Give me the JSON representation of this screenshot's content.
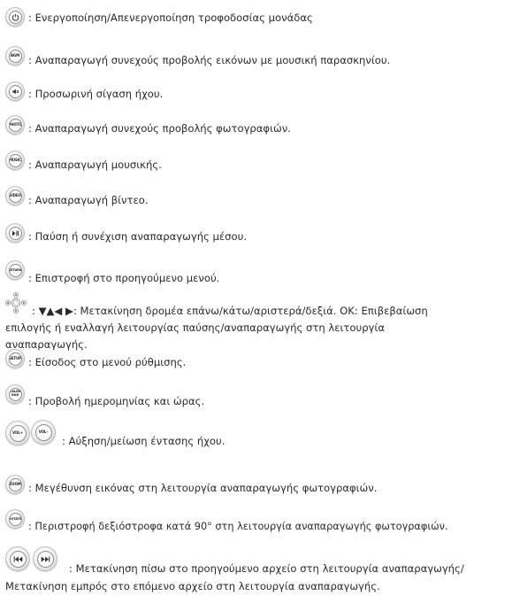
{
  "items": [
    {
      "icon": "power-icon",
      "label": "",
      "text": ": Ενεργοποίηση/Απενεργοποίηση τροφοδοσίας μονάδας"
    },
    {
      "icon": "bgm-icon",
      "label": "BGM",
      "text": ": Αναπαραγωγή συνεχούς προβολής εικόνων με μουσική παρασκηνίου."
    },
    {
      "icon": "mute-icon",
      "label": "",
      "text": ": Προσωρινή σίγαση ήχου."
    },
    {
      "icon": "photo-icon",
      "label": "PHOTO",
      "text": ": Αναπαραγωγή συνεχούς προβολής φωτογραφιών."
    },
    {
      "icon": "music-icon",
      "label": "MUSIC",
      "text": ": Αναπαραγωγή μουσικής."
    },
    {
      "icon": "video-icon",
      "label": "VIDEO",
      "text": ": Αναπαραγωγή βίντεο."
    },
    {
      "icon": "play-pause-icon",
      "label": "",
      "text": ": Παύση ή συνέχιση αναπαραγωγής μέσου."
    },
    {
      "icon": "return-icon",
      "label": "RETURN",
      "text": ": Επιστροφή στο προηγούμενο μενού."
    },
    {
      "icon": "navigation-pad-icon",
      "label": "",
      "text_line1": ": ▼▲◀ ▶: Μετακίνηση δρομέα επάνω/κάτω/αριστερά/δεξιά. OK: Επιβεβαίωση",
      "text_rest": "επιλογής ή εναλλαγή λειτουργίας παύσης/αναπαραγωγής στη λειτουργία αναπαραγωγής."
    },
    {
      "icon": "setup-icon",
      "label": "SETUP",
      "text": ": Είσοδος στο μενού ρύθμισης."
    },
    {
      "icon": "calendar-icon",
      "label": "CALEN DAR",
      "text": ": Προβολή ημερομηνίας και ώρας."
    },
    {
      "icon": "volume-icon",
      "label_a": "VOL+",
      "label_b": "VOL–",
      "text": ": Αύξηση/μείωση έντασης ήχου."
    },
    {
      "icon": "zoom-icon",
      "label": "ZOOM",
      "text": ": Μεγέθυνση εικόνας στη λειτουργία αναπαραγωγής φωτογραφιών."
    },
    {
      "icon": "rotate-icon",
      "label": "ROTATE",
      "text": ": Περιστροφή δεξιόστροφα κατά 90° στη λειτουργία αναπαραγωγής φωτογραφιών."
    },
    {
      "icon": "skip-icon",
      "label": "",
      "text_line1": ": Μετακίνηση πίσω στο προηγούμενο αρχείο στη λειτουργία αναπαραγωγής/",
      "text_rest": "Μετακίνηση εμπρός στο επόμενο αρχείο στη λειτουργία αναπαραγωγής."
    }
  ]
}
